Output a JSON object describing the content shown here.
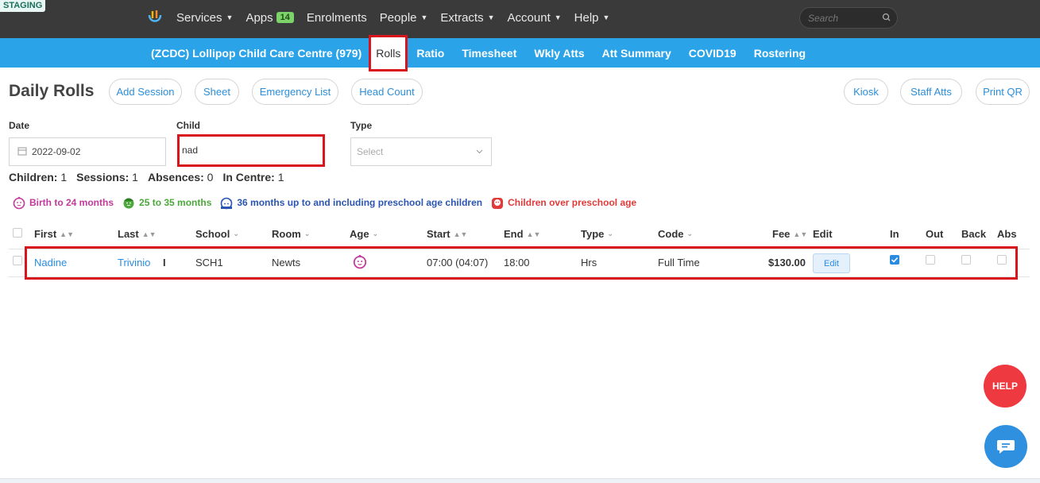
{
  "env_badge": "STAGING",
  "topnav": {
    "items": [
      {
        "label": "Services",
        "caret": true
      },
      {
        "label": "Apps",
        "badge": "14"
      },
      {
        "label": "Enrolments"
      },
      {
        "label": "People",
        "caret": true
      },
      {
        "label": "Extracts",
        "caret": true
      },
      {
        "label": "Account",
        "caret": true
      },
      {
        "label": "Help",
        "caret": true
      }
    ],
    "search_placeholder": "Search"
  },
  "subnav": {
    "centre": "(ZCDC) Lollipop Child Care Centre (979)",
    "tabs": [
      "Rolls",
      "Ratio",
      "Timesheet",
      "Wkly Atts",
      "Att Summary",
      "COVID19",
      "Rostering"
    ],
    "active": "Rolls"
  },
  "page": {
    "title": "Daily Rolls",
    "left_buttons": [
      "Add Session",
      "Sheet",
      "Emergency List",
      "Head Count"
    ],
    "right_buttons": [
      "Kiosk",
      "Staff Atts",
      "Print QR"
    ]
  },
  "filters": {
    "date_label": "Date",
    "date_value": "2022-09-02",
    "child_label": "Child",
    "child_value": "nad",
    "type_label": "Type",
    "type_placeholder": "Select"
  },
  "stats": {
    "children_label": "Children:",
    "children": "1",
    "sessions_label": "Sessions:",
    "sessions": "1",
    "absences_label": "Absences:",
    "absences": "0",
    "in_centre_label": "In Centre:",
    "in_centre": "1"
  },
  "legend": [
    {
      "label": "Birth to 24 months",
      "color": "#c2399a"
    },
    {
      "label": "25 to 35 months",
      "color": "#4aa83a"
    },
    {
      "label": "36 months up to and including preschool age children",
      "color": "#2a55b0"
    },
    {
      "label": "Children over preschool age",
      "color": "#e03a3a"
    }
  ],
  "table": {
    "headers": [
      "First",
      "Last",
      "School",
      "Room",
      "Age",
      "Start",
      "End",
      "Type",
      "Code",
      "Fee",
      "Edit",
      "In",
      "Out",
      "Back",
      "Abs"
    ],
    "rows": [
      {
        "first": "Nadine",
        "last": "Trivinio",
        "marker": "I",
        "school": "SCH1",
        "room": "Newts",
        "age_icon": "baby-face-icon",
        "start": "07:00 (04:07)",
        "end": "18:00",
        "type": "Hrs",
        "code": "Full Time",
        "fee": "$130.00",
        "edit_label": "Edit",
        "in": true,
        "out": false,
        "back": false,
        "abs": false
      }
    ]
  },
  "help_label": "HELP"
}
